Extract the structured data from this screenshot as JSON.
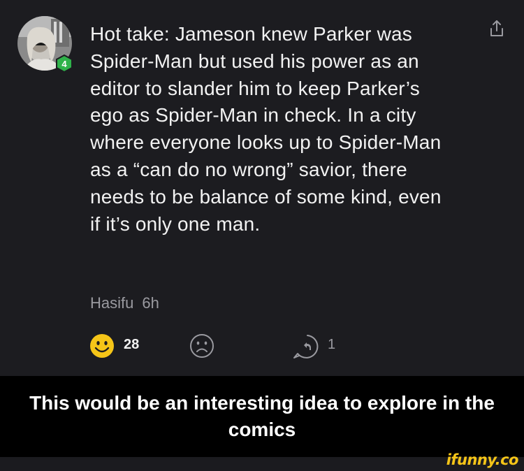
{
  "comment": {
    "user_level": "4",
    "text": "Hot take: Jameson knew Parker was Spider-Man but used his power as an editor to slander him to keep Parker’s ego as Spider-Man in check. In a city where everyone looks up to Spider-Man as a “can do no wrong” savior, there needs to be balance of some kind, even if it’s only one man.",
    "username": "Hasifu",
    "time": "6h",
    "smile_count": "28",
    "reply_count": "1"
  },
  "caption": "This would be an interesting idea to explore in the comics",
  "watermark": "ifunny.co",
  "colors": {
    "background": "#1c1c20",
    "text": "#f2f2f2",
    "meta": "#9a9aa0",
    "smile_yellow": "#f5c518",
    "level_green": "#2fb24a"
  },
  "icons": {
    "share": "share-icon",
    "smile": "smile-icon",
    "unsmile": "unsmile-icon",
    "reply": "reply-icon"
  }
}
